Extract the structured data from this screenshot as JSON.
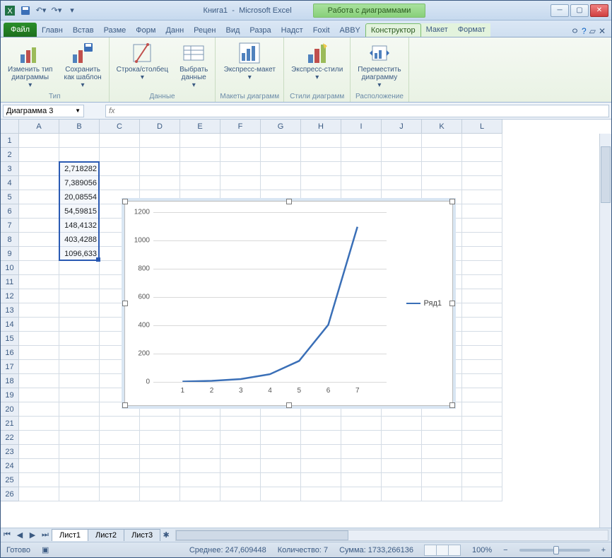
{
  "title": {
    "doc": "Книга1",
    "app": "Microsoft Excel",
    "charttools": "Работа с диаграммами"
  },
  "qat": {
    "save": "save-icon",
    "undo": "undo-icon",
    "redo": "redo-icon"
  },
  "tabs": {
    "file": "Файл",
    "items": [
      "Главн",
      "Встав",
      "Разме",
      "Форм",
      "Данн",
      "Рецен",
      "Вид",
      "Разра",
      "Надст",
      "Foxit",
      "ABBY"
    ],
    "chart": [
      "Конструктор",
      "Макет",
      "Формат"
    ]
  },
  "ribbon": {
    "groups": [
      {
        "name": "Тип",
        "buttons": [
          {
            "k": "change",
            "l": "Изменить тип\nдиаграммы"
          },
          {
            "k": "save",
            "l": "Сохранить\nкак шаблон"
          }
        ]
      },
      {
        "name": "Данные",
        "buttons": [
          {
            "k": "rowcol",
            "l": "Строка/столбец"
          },
          {
            "k": "select",
            "l": "Выбрать\nданные"
          }
        ]
      },
      {
        "name": "Макеты диаграмм",
        "buttons": [
          {
            "k": "layout",
            "l": "Экспресс-макет"
          }
        ]
      },
      {
        "name": "Стили диаграмм",
        "buttons": [
          {
            "k": "styles",
            "l": "Экспресс-стили"
          }
        ]
      },
      {
        "name": "Расположение",
        "buttons": [
          {
            "k": "move",
            "l": "Переместить\nдиаграмму"
          }
        ]
      }
    ]
  },
  "namebox": "Диаграмма 3",
  "fx": "fx",
  "columns": [
    "A",
    "B",
    "C",
    "D",
    "E",
    "F",
    "G",
    "H",
    "I",
    "J",
    "K",
    "L"
  ],
  "rowcount": 26,
  "cells": [
    {
      "r": 3,
      "c": 1,
      "v": "2,718282"
    },
    {
      "r": 4,
      "c": 1,
      "v": "7,389056"
    },
    {
      "r": 5,
      "c": 1,
      "v": "20,08554"
    },
    {
      "r": 6,
      "c": 1,
      "v": "54,59815"
    },
    {
      "r": 7,
      "c": 1,
      "v": "148,4132"
    },
    {
      "r": 8,
      "c": 1,
      "v": "403,4288"
    },
    {
      "r": 9,
      "c": 1,
      "v": "1096,633"
    }
  ],
  "selection": {
    "r1": 3,
    "r2": 9,
    "c": 1
  },
  "chart_data": {
    "type": "line",
    "categories": [
      "1",
      "2",
      "3",
      "4",
      "5",
      "6",
      "7"
    ],
    "values": [
      2.718282,
      7.389056,
      20.08554,
      54.59815,
      148.4132,
      403.4288,
      1096.633
    ],
    "series_name": "Ряд1",
    "ylim": [
      0,
      1200
    ],
    "yticks": [
      0,
      200,
      400,
      600,
      800,
      1000,
      1200
    ]
  },
  "sheets": [
    "Лист1",
    "Лист2",
    "Лист3"
  ],
  "status": {
    "ready": "Готово",
    "avg_lbl": "Среднее:",
    "avg": "247,609448",
    "cnt_lbl": "Количество:",
    "cnt": "7",
    "sum_lbl": "Сумма:",
    "sum": "1733,266136",
    "zoom": "100%"
  }
}
